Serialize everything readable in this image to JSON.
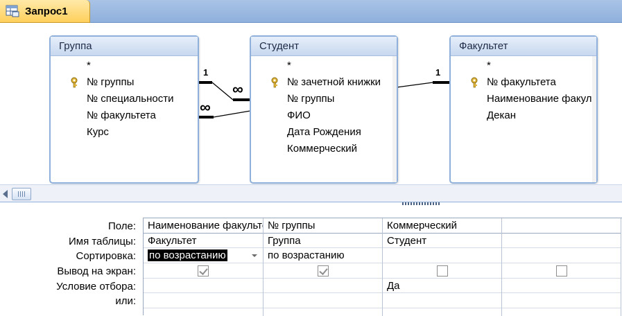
{
  "tab": {
    "label": "Запрос1",
    "icon": "query-icon"
  },
  "tables": [
    {
      "title": "Группа",
      "fields": [
        {
          "name": "*",
          "key": false
        },
        {
          "name": "№ группы",
          "key": true
        },
        {
          "name": "№ специальности",
          "key": false
        },
        {
          "name": "№ факультета",
          "key": false
        },
        {
          "name": "Курс",
          "key": false
        }
      ]
    },
    {
      "title": "Студент",
      "fields": [
        {
          "name": "*",
          "key": false
        },
        {
          "name": "№ зачетной книжки",
          "key": true
        },
        {
          "name": "№ группы",
          "key": false
        },
        {
          "name": "ФИО",
          "key": false
        },
        {
          "name": "Дата Рождения",
          "key": false
        },
        {
          "name": "Коммерческий",
          "key": false
        }
      ]
    },
    {
      "title": "Факультет",
      "fields": [
        {
          "name": "*",
          "key": false
        },
        {
          "name": "№ факультета",
          "key": true
        },
        {
          "name": "Наименование факультета",
          "key": false
        },
        {
          "name": "Декан",
          "key": false
        }
      ]
    }
  ],
  "relationships": [
    {
      "from": "Группа.№ группы",
      "to": "Студент.№ группы",
      "from_label": "1",
      "to_label": "∞"
    },
    {
      "from": "Группа.№ факультета",
      "to": "Факультет.№ факультета",
      "from_label": "∞",
      "to_label": "1"
    }
  ],
  "qbe": {
    "row_labels": [
      "Поле:",
      "Имя таблицы:",
      "Сортировка:",
      "Вывод на экран:",
      "Условие отбора:",
      "или:"
    ],
    "columns": [
      {
        "field": "Наименование факультета",
        "table": "Факультет",
        "sort": "по возрастанию",
        "show": true,
        "criteria": "",
        "or": ""
      },
      {
        "field": "№ группы",
        "table": "Группа",
        "sort": "по возрастанию",
        "show": true,
        "criteria": "",
        "or": ""
      },
      {
        "field": "Коммерческий",
        "table": "Студент",
        "sort": "",
        "show": false,
        "criteria": "Да",
        "or": ""
      },
      {
        "field": "",
        "table": "",
        "sort": "",
        "show": false,
        "criteria": "",
        "or": ""
      }
    ]
  }
}
